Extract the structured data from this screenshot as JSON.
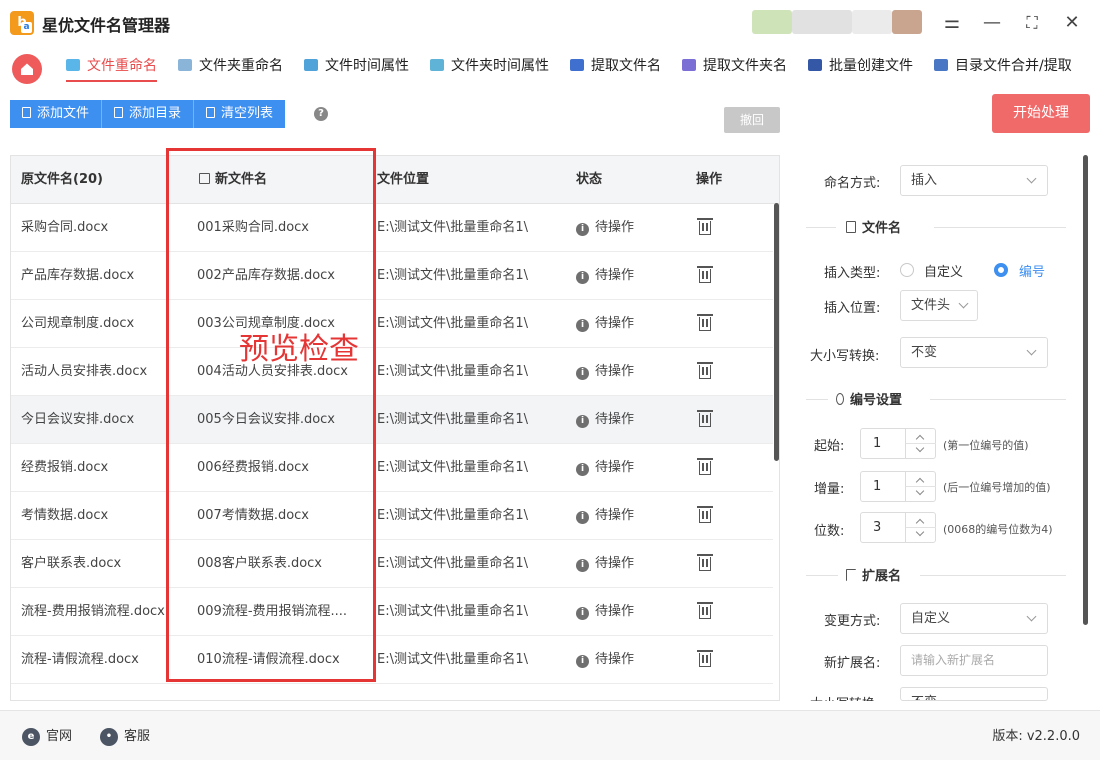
{
  "app": {
    "title": "星优文件名管理器",
    "logo_letters": "ba"
  },
  "window_controls": {
    "settings": "⚌",
    "minimize": "—",
    "maximize": "⛶",
    "close": "✕"
  },
  "tabs": [
    {
      "label": "文件重命名",
      "active": true
    },
    {
      "label": "文件夹重命名"
    },
    {
      "label": "文件时间属性"
    },
    {
      "label": "文件夹时间属性"
    },
    {
      "label": "提取文件名"
    },
    {
      "label": "提取文件夹名"
    },
    {
      "label": "批量创建文件"
    },
    {
      "label": "目录文件合并/提取"
    }
  ],
  "toolbar": {
    "add_file": "添加文件",
    "add_dir": "添加目录",
    "clear_list": "清空列表",
    "help": "?",
    "undo": "撤回",
    "start": "开始处理"
  },
  "table": {
    "headers": {
      "original": "原文件名(20)",
      "new": "新文件名",
      "location": "文件位置",
      "status": "状态",
      "action": "操作"
    },
    "rows": [
      {
        "original": "采购合同.docx",
        "new": "001采购合同.docx",
        "location": "E:\\测试文件\\批量重命名1\\",
        "status": "待操作"
      },
      {
        "original": "产品库存数据.docx",
        "new": "002产品库存数据.docx",
        "location": "E:\\测试文件\\批量重命名1\\",
        "status": "待操作"
      },
      {
        "original": "公司规章制度.docx",
        "new": "003公司规章制度.docx",
        "location": "E:\\测试文件\\批量重命名1\\",
        "status": "待操作"
      },
      {
        "original": "活动人员安排表.docx",
        "new": "004活动人员安排表.docx",
        "location": "E:\\测试文件\\批量重命名1\\",
        "status": "待操作"
      },
      {
        "original": "今日会议安排.docx",
        "new": "005今日会议安排.docx",
        "location": "E:\\测试文件\\批量重命名1\\",
        "status": "待操作"
      },
      {
        "original": "经费报销.docx",
        "new": "006经费报销.docx",
        "location": "E:\\测试文件\\批量重命名1\\",
        "status": "待操作"
      },
      {
        "original": "考情数据.docx",
        "new": "007考情数据.docx",
        "location": "E:\\测试文件\\批量重命名1\\",
        "status": "待操作"
      },
      {
        "original": "客户联系表.docx",
        "new": "008客户联系表.docx",
        "location": "E:\\测试文件\\批量重命名1\\",
        "status": "待操作"
      },
      {
        "original": "流程-费用报销流程.docx",
        "new": "009流程-费用报销流程....",
        "location": "E:\\测试文件\\批量重命名1\\",
        "status": "待操作"
      },
      {
        "original": "流程-请假流程.docx",
        "new": "010流程-请假流程.docx",
        "location": "E:\\测试文件\\批量重命名1\\",
        "status": "待操作"
      }
    ]
  },
  "annotation": {
    "text": "预览检查",
    "color": "#e53535"
  },
  "panel": {
    "naming_mode_label": "命名方式:",
    "naming_mode_value": "插入",
    "section_filename": "文件名",
    "insert_type_label": "插入类型:",
    "insert_type_options": [
      "自定义",
      "编号"
    ],
    "insert_type_selected": "编号",
    "insert_pos_label": "插入位置:",
    "insert_pos_value": "文件头",
    "case_label": "大小写转换:",
    "case_value": "不变",
    "section_numbering": "编号设置",
    "start_label": "起始:",
    "start_value": "1",
    "start_hint": "(第一位编号的值)",
    "inc_label": "增量:",
    "inc_value": "1",
    "inc_hint": "(后一位编号增加的值)",
    "digits_label": "位数:",
    "digits_value": "3",
    "digits_hint": "(0068的编号位数为4)",
    "section_ext": "扩展名",
    "ext_mode_label": "变更方式:",
    "ext_mode_value": "自定义",
    "new_ext_label": "新扩展名:",
    "new_ext_placeholder": "请输入新扩展名",
    "ext_case_label": "大小写转换:",
    "ext_case_value": "不变"
  },
  "footer": {
    "website": "官网",
    "support": "客服",
    "version": "版本: v2.2.0.0"
  },
  "colors": {
    "accent_red": "#e94c4c",
    "accent_blue": "#3d8ff0",
    "start_button": "#f06a6a"
  }
}
